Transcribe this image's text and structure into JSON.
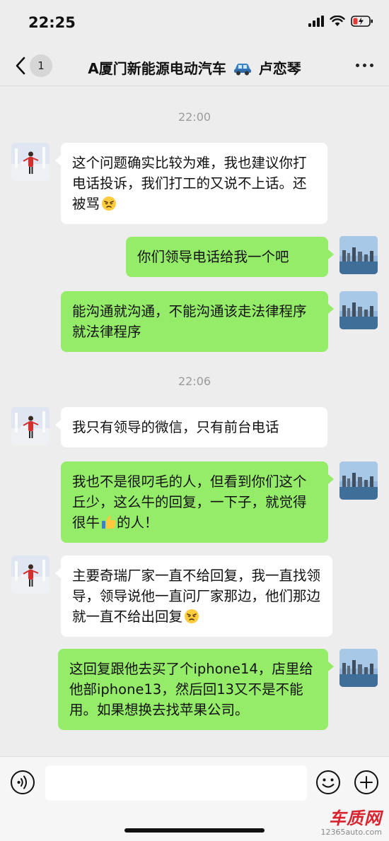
{
  "status": {
    "time": "22:25"
  },
  "nav": {
    "unread": "1",
    "title_pre": "A厦门新能源电动汽车",
    "title_post": "卢恋琴"
  },
  "timestamps": [
    "22:00",
    "22:06"
  ],
  "messages": [
    {
      "from": "contact",
      "text": "这个问题确实比较为难，我也建议你打电话投诉，我们打工的又说不上话。还被骂",
      "emoji": "annoyed-face-emoji"
    },
    {
      "from": "me",
      "text": "你们领导电话给我一个吧"
    },
    {
      "from": "me",
      "text": "能沟通就沟通，不能沟通该走法律程序就法律程序"
    },
    {
      "from": "contact",
      "text": "我只有领导的微信，只有前台电话"
    },
    {
      "from": "me",
      "text_pre": "我也不是很叼毛的人，但看到你们这个丘少，这么牛的回复，一下子，就觉得很牛",
      "emoji": "thumbs-up-emoji",
      "text_post": "的人！"
    },
    {
      "from": "contact",
      "text": "主要奇瑞厂家一直不给回复，我一直找领导，领导说他一直问厂家那边，他们那边就一直不给出回复",
      "emoji": "annoyed-face-emoji"
    },
    {
      "from": "me",
      "text": "这回复跟他去买了个iphone14，店里给他部iphone13，然后回13又不是不能用。如果想换去找苹果公司。"
    }
  ],
  "input": {
    "placeholder": ""
  },
  "watermark": {
    "main": "车质网",
    "sub": "12365auto.com"
  },
  "colors": {
    "sent_bubble": "#95ec69",
    "received_bubble": "#ffffff",
    "background": "#ededed"
  }
}
